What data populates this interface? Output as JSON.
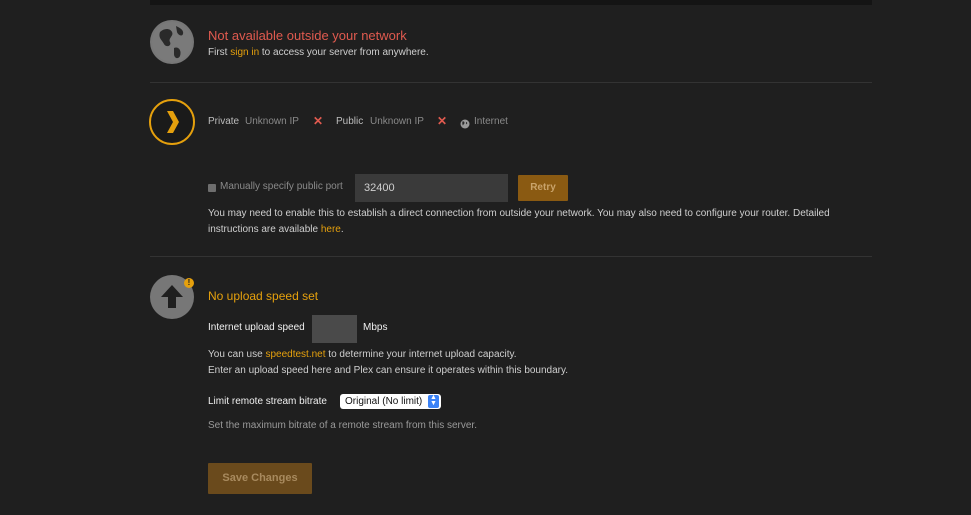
{
  "remote_access": {
    "status_title": "Not available outside your network",
    "signin_prefix": "First ",
    "signin_link": "sign in",
    "signin_suffix": " to access your server from anywhere."
  },
  "connection": {
    "private_label": "Private",
    "private_value": "Unknown IP",
    "public_label": "Public",
    "public_value": "Unknown IP",
    "internet_label": "Internet",
    "status_icon": "x-mark-icon"
  },
  "port": {
    "checkbox_label": "Manually specify public port",
    "port_value": "32400",
    "retry_label": "Retry",
    "help_line1": "You may need to enable this to establish a direct connection from outside your network. You may also need to configure your router. Detailed",
    "help_line2_prefix": "instructions are available ",
    "help_link": "here",
    "help_line2_suffix": "."
  },
  "upload": {
    "title": "No upload speed set",
    "speed_label": "Internet upload speed",
    "speed_value": "",
    "unit": "Mbps",
    "help_prefix": "You can use ",
    "help_link": "speedtest.net",
    "help_suffix": " to determine your internet upload capacity.",
    "help_line2": "Enter an upload speed here and Plex can ensure it operates within this boundary.",
    "bitrate_label": "Limit remote stream bitrate",
    "bitrate_selected": "Original (No limit)",
    "bitrate_help": "Set the maximum bitrate of a remote stream from this server."
  },
  "actions": {
    "save_label": "Save Changes"
  },
  "colors": {
    "accent": "#e5a00d",
    "error": "#e05a4f",
    "background": "#1f1f1f"
  }
}
